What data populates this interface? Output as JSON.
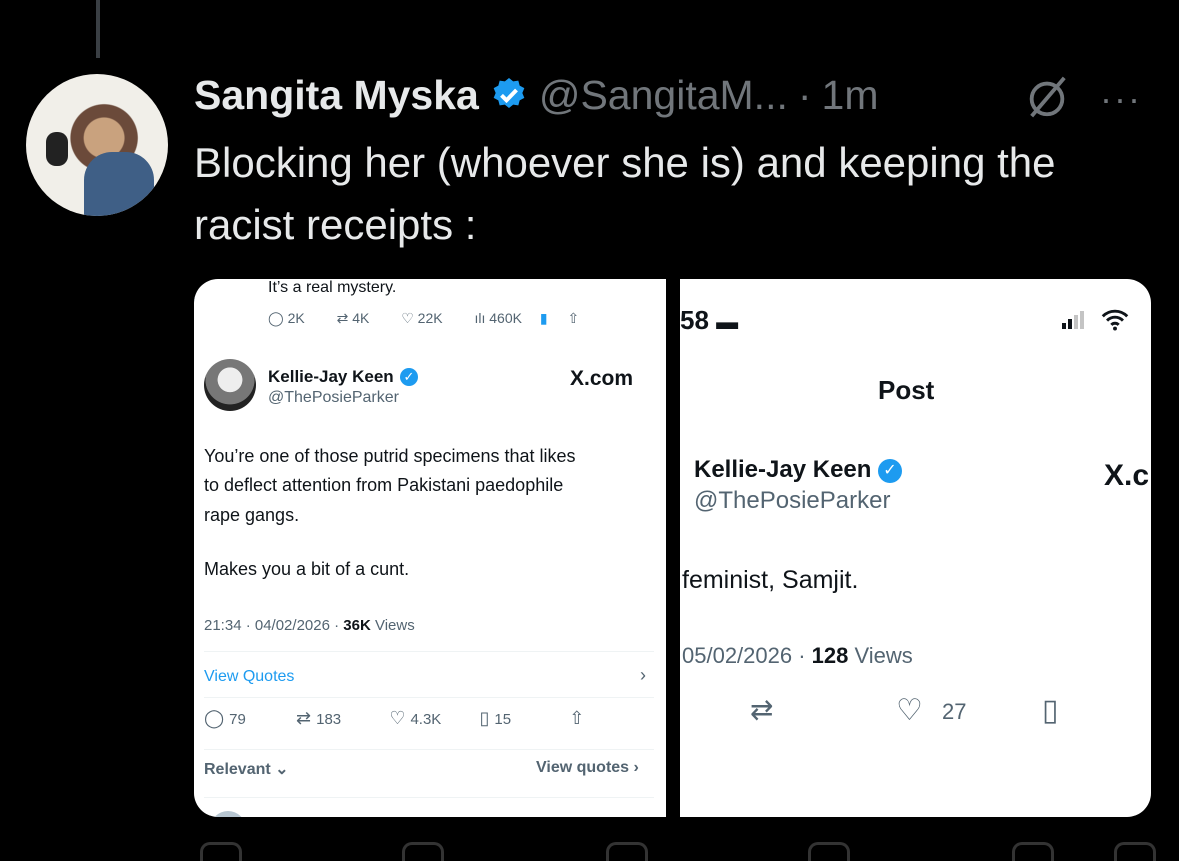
{
  "tweet": {
    "author_name": "Sangita Myska",
    "handle": "@SangitaM...",
    "separator": "·",
    "time": "1m",
    "text": "Blocking her (whoever she is) and keeping the racist receipts :",
    "more": "···"
  },
  "shot_a": {
    "top_text": "It’s a real mystery.",
    "top_replies": "2K",
    "top_reposts": "4K",
    "top_likes": "22K",
    "top_views": "460K",
    "author_name": "Kellie-Jay Keen",
    "author_handle": "@ThePosieParker",
    "brand": "X.com",
    "body_line1": "You’re one of those putrid specimens that likes",
    "body_line2": "to deflect attention from Pakistani paedophile",
    "body_line3": "rape gangs.",
    "body_line4": "Makes you a bit of a cunt.",
    "meta_time": "21:34 · 04/02/2026 ·",
    "meta_views_count": "36K",
    "meta_views_label": "Views",
    "view_quotes": "View Quotes",
    "chevron": "›",
    "replies": "79",
    "reposts": "183",
    "likes": "4.3K",
    "bookmarks": "15",
    "relevant": "Relevant",
    "view_quotes_bottom": "View quotes ›"
  },
  "shot_b": {
    "status_time": "58",
    "title": "Post",
    "author_name": "Kellie-Jay Keen",
    "author_handle": "@ThePosieParker",
    "brand": "X.c",
    "body": "feminist,  Samjit.",
    "meta_date": "05/02/2026 ·",
    "meta_views_count": "128",
    "meta_views_label": "Views",
    "likes": "27"
  },
  "colors": {
    "bg": "#000000",
    "text": "#e7e9ea",
    "muted": "#71767b",
    "verified": "#1d9bf0"
  }
}
